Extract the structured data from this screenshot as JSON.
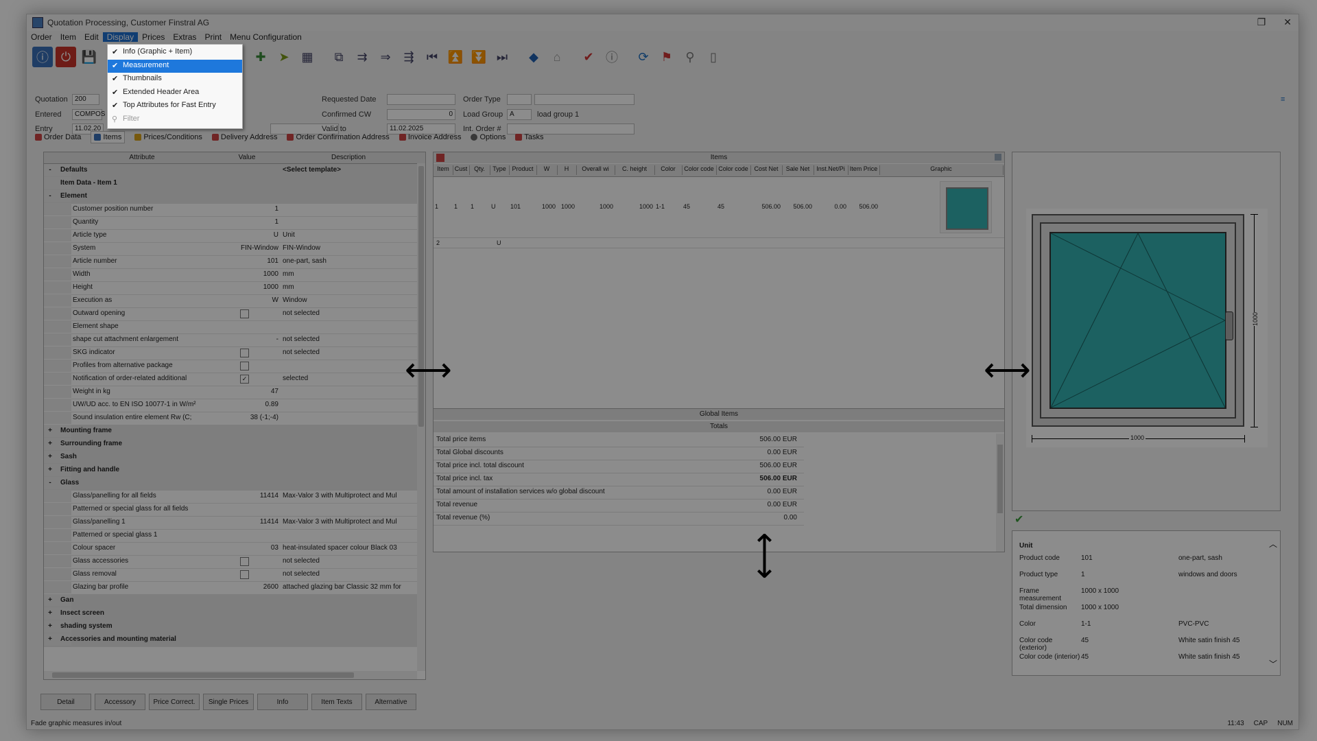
{
  "window": {
    "title": "Quotation Processing, Customer Finstral AG",
    "controls": [
      "❐",
      "✕"
    ]
  },
  "menu": [
    "Order",
    "Item",
    "Edit",
    "Display",
    "Prices",
    "Extras",
    "Print",
    "Menu Configuration"
  ],
  "display_menu": [
    {
      "label": "Info (Graphic + Item)",
      "checked": true,
      "state": "normal"
    },
    {
      "label": "Measurement",
      "checked": true,
      "state": "highlight"
    },
    {
      "label": "Thumbnails",
      "checked": true,
      "state": "normal"
    },
    {
      "label": "Extended Header Area",
      "checked": true,
      "state": "normal"
    },
    {
      "label": "Top Attributes for Fast Entry",
      "checked": true,
      "state": "normal"
    },
    {
      "label": "Filter",
      "checked": false,
      "state": "disabled"
    }
  ],
  "header": {
    "quotation_label": "Quotation",
    "quotation_value": "200",
    "entered_label": "Entered",
    "entered_value": "COMPOS",
    "entry_label": "Entry",
    "entry_value": "11.02.20",
    "requested_date_label": "Requested Date",
    "confirmed_cw_label": "Confirmed CW",
    "confirmed_cw_value": "0",
    "valid_to_label": "Valid to",
    "valid_to_value": "11.02.2025",
    "order_type_label": "Order Type",
    "load_group_label": "Load Group",
    "load_group_value": "A",
    "load_group_desc": "load group 1",
    "int_order_label": "Int. Order #"
  },
  "tabs": [
    "Order Data",
    "Items",
    "Prices/Conditions",
    "Delivery Address",
    "Order Confirmation Address",
    "Invoice Address",
    "Options",
    "Tasks"
  ],
  "attr_grid": {
    "columns": [
      "Attribute",
      "Value",
      "Description"
    ],
    "rows": [
      {
        "t": "g",
        "label": "Defaults",
        "desc": "<Select template>",
        "exp": "-"
      },
      {
        "t": "g",
        "label": "Item Data - Item 1",
        "exp": ""
      },
      {
        "t": "g",
        "label": "Element",
        "exp": "-"
      },
      {
        "t": "r",
        "label": "Customer position number",
        "value": "1"
      },
      {
        "t": "r",
        "label": "Quantity",
        "value": "1"
      },
      {
        "t": "r",
        "label": "Article type",
        "value": "U",
        "desc": "Unit"
      },
      {
        "t": "r",
        "label": "System",
        "value": "FIN-Window",
        "desc": "FIN-Window"
      },
      {
        "t": "r",
        "label": "Article number",
        "value": "101",
        "desc": "one-part, sash"
      },
      {
        "t": "r",
        "label": "Width",
        "value": "1000",
        "desc": "mm"
      },
      {
        "t": "r",
        "label": "Height",
        "value": "1000",
        "desc": "mm"
      },
      {
        "t": "r",
        "label": "Execution as",
        "value": "W",
        "desc": "Window"
      },
      {
        "t": "c",
        "label": "Outward opening",
        "desc": "not selected",
        "ck": ""
      },
      {
        "t": "r",
        "label": "Element shape"
      },
      {
        "t": "r",
        "label": "shape cut attachment enlargement",
        "value": "-",
        "desc": "not selected"
      },
      {
        "t": "c",
        "label": "SKG indicator",
        "desc": "not selected",
        "ck": ""
      },
      {
        "t": "c",
        "label": "Profiles from alternative package",
        "ck": ""
      },
      {
        "t": "c",
        "label": "Notification of order-related additional",
        "desc": "selected",
        "ck": "✓"
      },
      {
        "t": "r",
        "label": "Weight in kg",
        "value": "47"
      },
      {
        "t": "r",
        "label": "UW/UD acc. to EN ISO 10077-1 in W/m²",
        "value": "0.89"
      },
      {
        "t": "r",
        "label": "Sound insulation entire element Rw (C;",
        "value": "38 (-1;-4)"
      },
      {
        "t": "g",
        "label": "Mounting frame",
        "exp": "+"
      },
      {
        "t": "g",
        "label": "Surrounding frame",
        "exp": "+"
      },
      {
        "t": "g",
        "label": "Sash",
        "exp": "+"
      },
      {
        "t": "g",
        "label": "Fitting and handle",
        "exp": "+"
      },
      {
        "t": "g",
        "label": "Glass",
        "exp": "-"
      },
      {
        "t": "r",
        "label": "Glass/panelling for all fields",
        "value": "11414",
        "desc": "Max-Valor 3 with Multiprotect and Mul"
      },
      {
        "t": "r",
        "label": "Patterned or special glass for all fields"
      },
      {
        "t": "r",
        "label": "Glass/panelling 1",
        "value": "11414",
        "desc": "Max-Valor 3 with Multiprotect and Mul"
      },
      {
        "t": "r",
        "label": "Patterned or special glass 1"
      },
      {
        "t": "r",
        "label": "Colour spacer",
        "value": "03",
        "desc": "heat-insulated spacer colour Black 03"
      },
      {
        "t": "c",
        "label": "Glass accessories",
        "desc": "not selected",
        "ck": ""
      },
      {
        "t": "c",
        "label": "Glass removal",
        "desc": "not selected",
        "ck": ""
      },
      {
        "t": "r",
        "label": "Glazing bar profile",
        "value": "2600",
        "desc": "attached glazing bar Classic 32 mm for"
      },
      {
        "t": "g",
        "label": "Gan",
        "exp": "+"
      },
      {
        "t": "g",
        "label": "Insect screen",
        "exp": "+"
      },
      {
        "t": "g",
        "label": "shading system",
        "exp": "+"
      },
      {
        "t": "g",
        "label": "Accessories and mounting material",
        "exp": "+"
      }
    ]
  },
  "items": {
    "title": "Items",
    "columns": [
      "Item",
      "Cust",
      "Qty.",
      "Type",
      "Product",
      "W",
      "H",
      "Overall wi",
      "C. height",
      "Color",
      "Color code",
      "Color code",
      "Cost Net",
      "Sale Net",
      "Inst.Net/Pi",
      "Item Price",
      "Graphic"
    ],
    "row1": [
      "1",
      "1",
      "1",
      "U",
      "101",
      "1000",
      "1000",
      "1000",
      "1000",
      "1-1",
      "45",
      "45",
      "506.00",
      "506.00",
      "0.00",
      "506.00"
    ],
    "row2_item": "2",
    "row2_type": "U"
  },
  "global_items": "Global Items",
  "totals": {
    "title": "Totals",
    "rows": [
      {
        "label": "Total price items",
        "value": "506.00 EUR"
      },
      {
        "label": "Total Global discounts",
        "value": "0.00 EUR"
      },
      {
        "label": "Total price incl. total discount",
        "value": "506.00 EUR"
      },
      {
        "label": "Total price incl. tax",
        "value": "506.00 EUR"
      },
      {
        "label": "Total amount of installation services w/o global discount",
        "value": "0.00 EUR"
      },
      {
        "label": "Total revenue",
        "value": "0.00 EUR"
      },
      {
        "label": "Total revenue (%)",
        "value": "0.00"
      }
    ]
  },
  "graphic": {
    "width_label": "1000",
    "height_label": "1000",
    "glass_color": "#33b1b1"
  },
  "info": {
    "section": "Unit",
    "rows": [
      {
        "label": "Product code",
        "value": "101",
        "desc": "one-part, sash"
      },
      {
        "label": "Product type",
        "value": "1",
        "desc": "windows and doors"
      },
      {
        "label": "Frame measurement",
        "value": "1000 x 1000",
        "desc": ""
      },
      {
        "label": "Total dimension",
        "value": "1000 x 1000",
        "desc": ""
      },
      {
        "label": "Color",
        "value": "1-1",
        "desc": "PVC-PVC"
      },
      {
        "label": "Color code (exterior)",
        "value": "45",
        "desc": "White satin finish 45"
      },
      {
        "label": "Color code (interior)",
        "value": "45",
        "desc": "White satin finish 45"
      }
    ]
  },
  "bottom_buttons": [
    "Detail",
    "Accessory",
    "Price Correct.",
    "Single Prices",
    "Info",
    "Item Texts",
    "Alternative"
  ],
  "status": {
    "text": "Fade graphic measures in/out",
    "time": "11:43",
    "caps": "CAP",
    "num": "NUM"
  },
  "colors": {
    "menu_highlight": "#1e78dc",
    "accent": "#1e6fd0",
    "glass": "#33b1b1"
  }
}
